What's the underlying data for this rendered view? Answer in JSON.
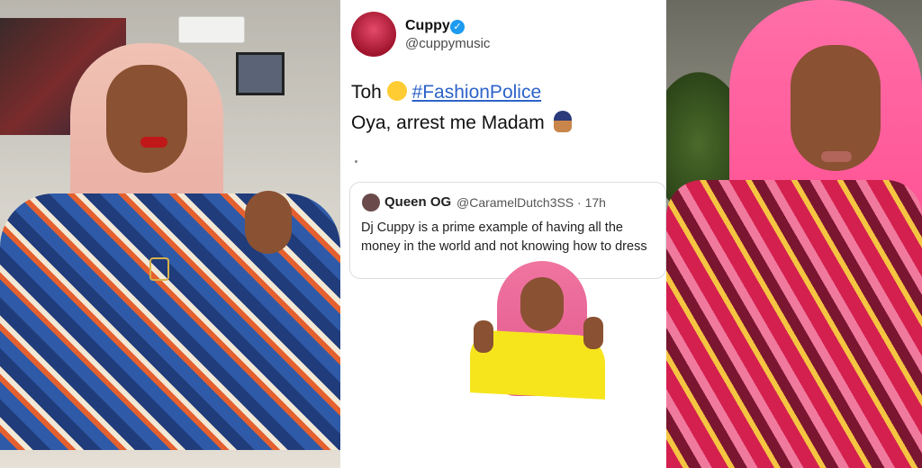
{
  "tweet": {
    "display_name": "Cuppy",
    "verified_mark": "✓",
    "handle": "@cuppymusic",
    "line1_prefix": "Toh",
    "hashtag": "#FashionPolice",
    "line2": "Oya, arrest me Madam",
    "quote": {
      "name": "Queen OG",
      "handle_time": "@CaramelDutch3SS · 17h",
      "text": "Dj Cuppy is a prime example of having all the money in the world and not knowing how to dress"
    }
  },
  "colors": {
    "link": "#2c63c9",
    "verified": "#1d9bf0"
  },
  "icons": {
    "verified": "verified-badge-icon",
    "laugh_emoji": "laughing-tears-emoji-icon",
    "police_emoji": "police-officer-emoji-icon"
  }
}
